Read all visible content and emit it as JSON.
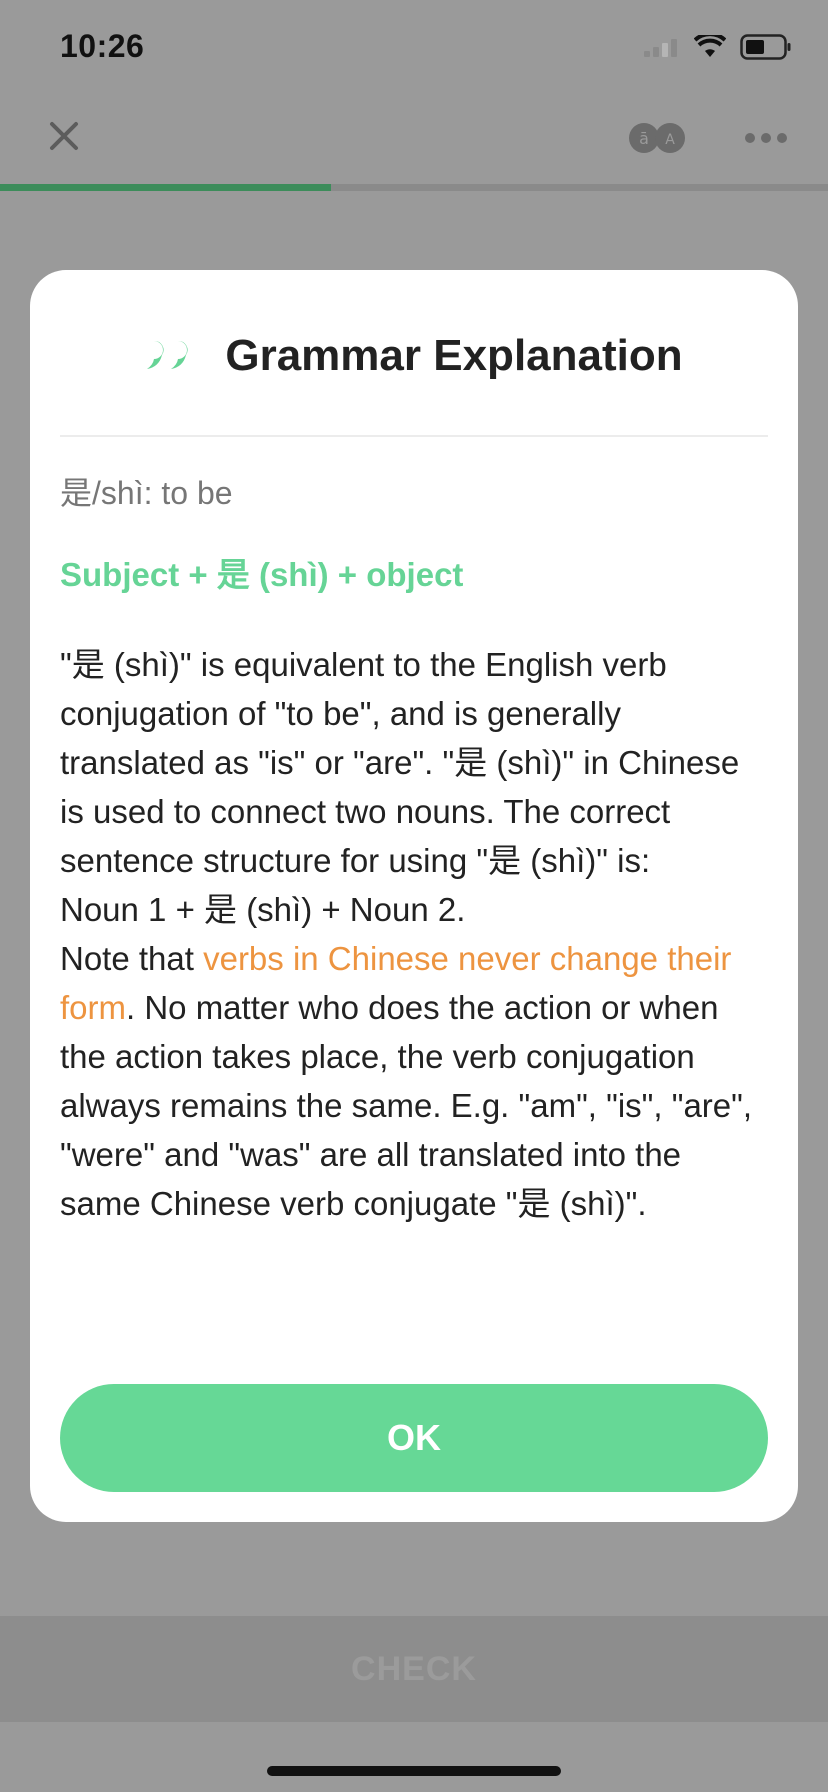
{
  "status_bar": {
    "time": "10:26"
  },
  "lesson": {
    "progress": 0.4,
    "check_label": "CHECK"
  },
  "colors": {
    "accent_green": "#66d896",
    "highlight_orange": "#ed9440"
  },
  "modal": {
    "icon": "quote-icon",
    "title": "Grammar Explanation",
    "pattern_caption": "是/shì: to be",
    "structure": "Subject + 是 (shì) + object",
    "explanation": {
      "p1": "\"是 (shì)\" is equivalent to the English verb conjugation of \"to be\", and is generally translated as \"is\" or \"are\". \"是 (shì)\" in Chinese is used to connect two nouns. The correct sentence structure for using \"是 (shì)\" is:",
      "p2": "Noun 1 + 是 (shì) + Noun 2.",
      "p3_prefix": "Note that ",
      "p3_highlight": "verbs in Chinese never change their form",
      "p3_suffix": ". No matter who does the action or when the action takes place, the verb conjugation always remains the same. E.g. \"am\", \"is\", \"are\", \"were\" and \"was\" are all translated into the same Chinese verb conjugate \"是 (shì)\"."
    },
    "ok_label": "OK"
  }
}
